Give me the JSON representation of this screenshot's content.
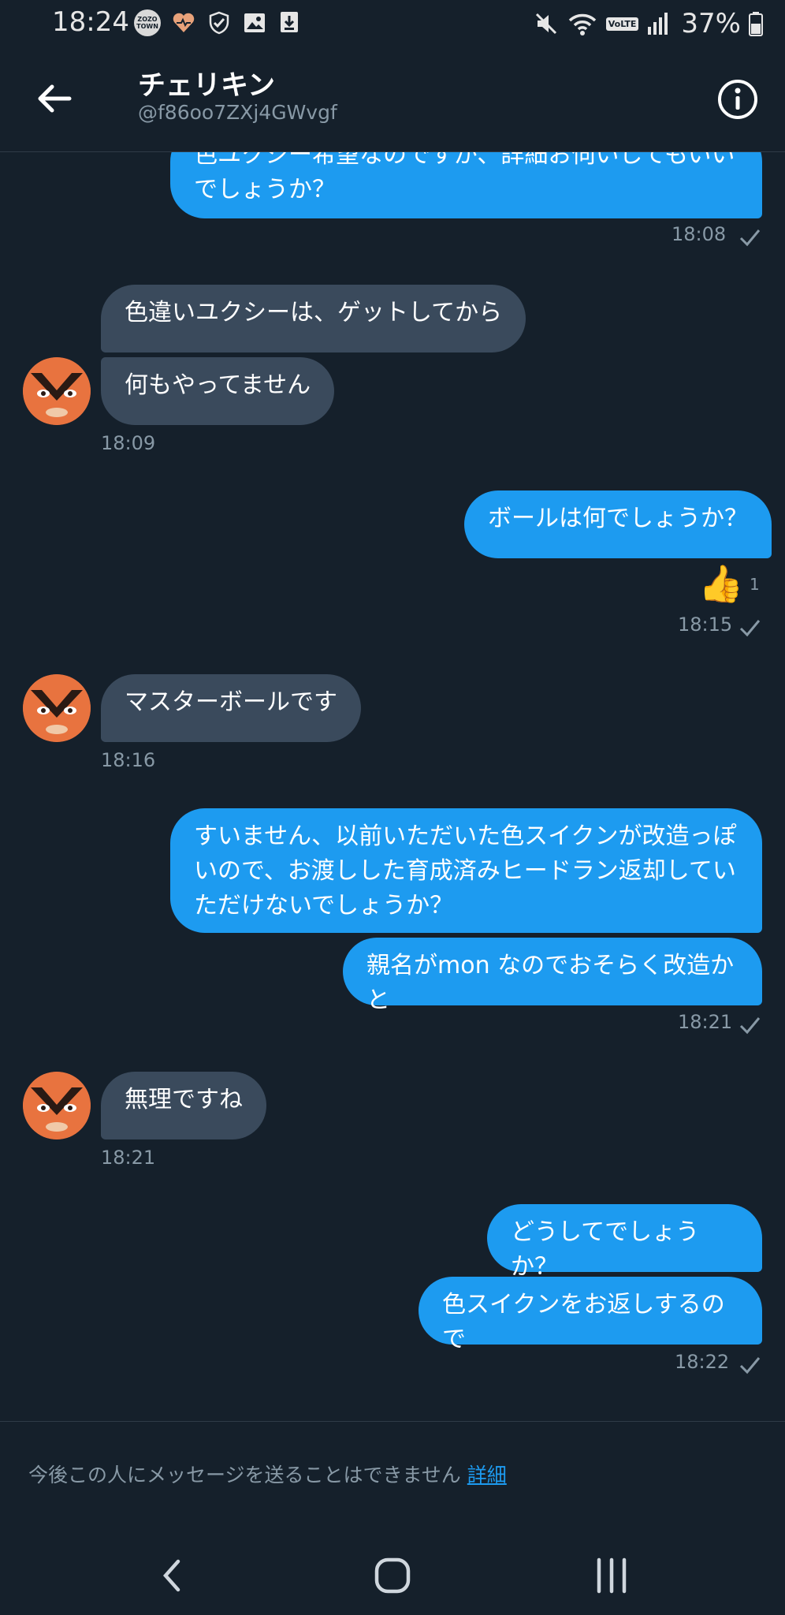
{
  "status": {
    "time": "18:24",
    "zozo_badge": "ZOZO TOWN",
    "battery": "37%",
    "volte": "VoLTE"
  },
  "header": {
    "name": "チェリキン",
    "handle": "@f86oo7ZXj4GWvgf"
  },
  "messages": [
    {
      "dir": "out",
      "text": "色ユクシー希望なのですが、詳細お伺いしてもいい\nでしょうか？"
    },
    {
      "dir": "in",
      "text": "色違いユクシーは、ゲットしてから"
    },
    {
      "dir": "in",
      "text": "何もやってません"
    },
    {
      "dir": "out",
      "text": "ボールは何でしょうか？"
    },
    {
      "dir": "in",
      "text": "マスターボールです"
    },
    {
      "dir": "out",
      "text": "すいません、以前いただいた色スイクンが改造っぽ\nいので、お渡しした育成済みヒードラン返却してい\nただけないでしょうか？"
    },
    {
      "dir": "out",
      "text": "親名がmon なのでおそらく改造かと"
    },
    {
      "dir": "in",
      "text": "無理ですね"
    },
    {
      "dir": "out",
      "text": "どうしてでしょうか？"
    },
    {
      "dir": "out",
      "text": "色スイクンをお返しするので"
    }
  ],
  "timestamps": [
    "18:08",
    "18:09",
    "18:15",
    "18:16",
    "18:21",
    "18:21",
    "18:22"
  ],
  "reaction": {
    "emoji": "👍",
    "count": "1"
  },
  "footer": {
    "notice": "今後この人にメッセージを送ることはできません",
    "link": "詳細"
  }
}
